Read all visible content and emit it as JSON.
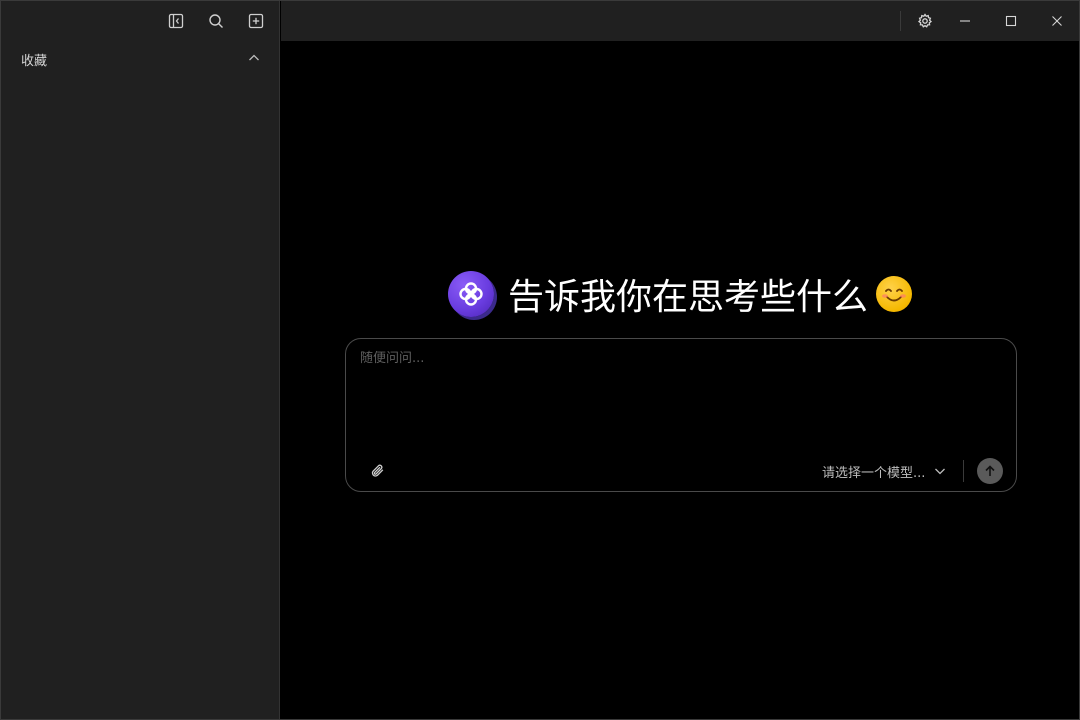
{
  "sidebar": {
    "toolbar": {
      "collapse_icon": "sidebar-collapse-icon",
      "search_icon": "search-icon",
      "new_chat_icon": "new-chat-icon"
    },
    "section": {
      "title": "收藏",
      "expanded": true,
      "chevron_icon": "chevron-up-icon"
    }
  },
  "titlebar": {
    "settings_icon": "gear-icon",
    "minimize_icon": "minimize-icon",
    "maximize_icon": "maximize-icon",
    "close_icon": "close-icon"
  },
  "main": {
    "hero": {
      "logo_icon": "app-logo-icon",
      "text": "告诉我你在思考些什么",
      "emoji_icon": "smiling-face-icon"
    },
    "composer": {
      "placeholder": "随便问问...",
      "value": "",
      "attach_icon": "paperclip-icon",
      "model_placeholder": "请选择一个模型...",
      "model_chevron_icon": "chevron-down-icon",
      "send_icon": "arrow-up-icon"
    }
  },
  "colors": {
    "background": "#000000",
    "sidebar": "#202020",
    "border": "#4a4a4a",
    "logo_purple": "#6a3de0",
    "send_button": "#5a5a5a"
  }
}
